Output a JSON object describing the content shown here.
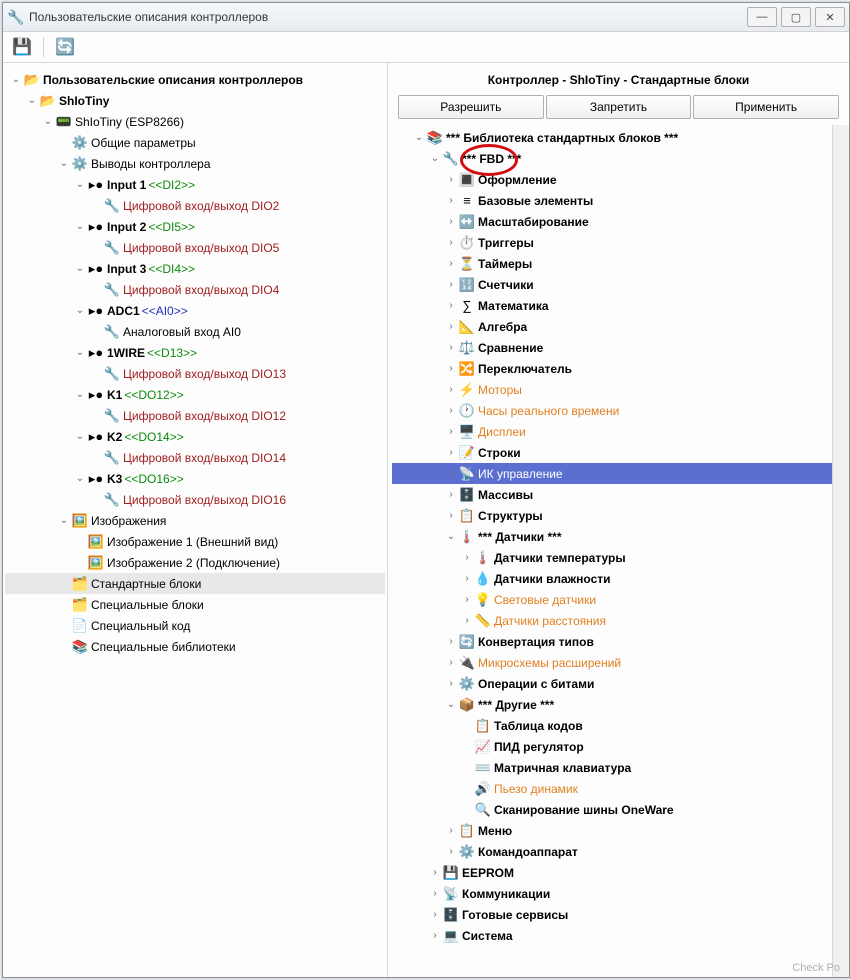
{
  "window_title": "Пользовательские описания контроллеров",
  "right_heading": "Контроллер - ShIoTiny - Стандартные блоки",
  "buttons": {
    "allow": "Разрешить",
    "deny": "Запретить",
    "apply": "Применить"
  },
  "left_tree": [
    {
      "ind": 0,
      "exp": "v",
      "ico": "📂",
      "lbl": "Пользовательские описания контроллеров",
      "b": true
    },
    {
      "ind": 1,
      "exp": "v",
      "ico": "📂",
      "lbl": "ShIoTiny",
      "b": true
    },
    {
      "ind": 2,
      "exp": "v",
      "ico": "📟",
      "lbl": "ShIoTiny (ESP8266)"
    },
    {
      "ind": 3,
      "exp": "",
      "ico": "⚙️",
      "lbl": "Общие параметры"
    },
    {
      "ind": 3,
      "exp": "v",
      "ico": "⚙️",
      "lbl": "Выводы контроллера"
    },
    {
      "ind": 4,
      "exp": "v",
      "ico": "▸●",
      "lbl": "Input 1 ",
      "b": true,
      "sfx": "<<DI2>>",
      "sfxc": "green"
    },
    {
      "ind": 5,
      "exp": "",
      "ico": "🔧",
      "lbl": "Цифровой вход/выход DIO2",
      "c": "red"
    },
    {
      "ind": 4,
      "exp": "v",
      "ico": "▸●",
      "lbl": "Input 2 ",
      "b": true,
      "sfx": "<<DI5>>",
      "sfxc": "green"
    },
    {
      "ind": 5,
      "exp": "",
      "ico": "🔧",
      "lbl": "Цифровой вход/выход DIO5",
      "c": "red"
    },
    {
      "ind": 4,
      "exp": "v",
      "ico": "▸●",
      "lbl": "Input 3 ",
      "b": true,
      "sfx": "<<DI4>>",
      "sfxc": "green"
    },
    {
      "ind": 5,
      "exp": "",
      "ico": "🔧",
      "lbl": "Цифровой вход/выход DIO4",
      "c": "red"
    },
    {
      "ind": 4,
      "exp": "v",
      "ico": "▸●",
      "lbl": "ADC1 ",
      "b": true,
      "sfx": "<<AI0>>",
      "sfxc": "blue"
    },
    {
      "ind": 5,
      "exp": "",
      "ico": "🔧",
      "lbl": "Аналоговый вход AI0"
    },
    {
      "ind": 4,
      "exp": "v",
      "ico": "▸●",
      "lbl": "1WIRE ",
      "b": true,
      "sfx": "<<D13>>",
      "sfxc": "green"
    },
    {
      "ind": 5,
      "exp": "",
      "ico": "🔧",
      "lbl": "Цифровой вход/выход DIO13",
      "c": "red"
    },
    {
      "ind": 4,
      "exp": "v",
      "ico": "▸●",
      "lbl": "K1 ",
      "b": true,
      "sfx": "<<DO12>>",
      "sfxc": "green"
    },
    {
      "ind": 5,
      "exp": "",
      "ico": "🔧",
      "lbl": "Цифровой вход/выход DIO12",
      "c": "red"
    },
    {
      "ind": 4,
      "exp": "v",
      "ico": "▸●",
      "lbl": "K2 ",
      "b": true,
      "sfx": "<<DO14>>",
      "sfxc": "green"
    },
    {
      "ind": 5,
      "exp": "",
      "ico": "🔧",
      "lbl": "Цифровой вход/выход DIO14",
      "c": "red"
    },
    {
      "ind": 4,
      "exp": "v",
      "ico": "▸●",
      "lbl": "K3 ",
      "b": true,
      "sfx": "<<DO16>>",
      "sfxc": "green"
    },
    {
      "ind": 5,
      "exp": "",
      "ico": "🔧",
      "lbl": "Цифровой вход/выход DIO16",
      "c": "red"
    },
    {
      "ind": 3,
      "exp": "v",
      "ico": "🖼️",
      "lbl": "Изображения"
    },
    {
      "ind": 4,
      "exp": "",
      "ico": "🖼️",
      "lbl": "Изображение 1 (Внешний вид)"
    },
    {
      "ind": 4,
      "exp": "",
      "ico": "🖼️",
      "lbl": "Изображение 2 (Подключение)"
    },
    {
      "ind": 3,
      "exp": "",
      "ico": "🗂️",
      "lbl": "Стандартные блоки",
      "sel": true
    },
    {
      "ind": 3,
      "exp": "",
      "ico": "🗂️",
      "lbl": "Специальные блоки"
    },
    {
      "ind": 3,
      "exp": "",
      "ico": "📄",
      "lbl": "Специальный код"
    },
    {
      "ind": 3,
      "exp": "",
      "ico": "📚",
      "lbl": "Специальные библиотеки"
    }
  ],
  "right_tree": [
    {
      "ind": 1,
      "exp": "v",
      "ico": "📚",
      "lbl": "*** Библиотека стандартных блоков ***",
      "b": true
    },
    {
      "ind": 2,
      "exp": "v",
      "ico": "🔧",
      "lbl": "*** FBD ***",
      "b": true
    },
    {
      "ind": 3,
      "exp": ">",
      "ico": "🔳",
      "lbl": "Оформление",
      "b": true
    },
    {
      "ind": 3,
      "exp": ">",
      "ico": "≡",
      "lbl": "Базовые элементы",
      "b": true
    },
    {
      "ind": 3,
      "exp": ">",
      "ico": "↔️",
      "lbl": "Масштабирование",
      "b": true
    },
    {
      "ind": 3,
      "exp": ">",
      "ico": "⏱️",
      "lbl": "Триггеры",
      "b": true
    },
    {
      "ind": 3,
      "exp": ">",
      "ico": "⏳",
      "lbl": "Таймеры",
      "b": true
    },
    {
      "ind": 3,
      "exp": ">",
      "ico": "🔢",
      "lbl": "Счетчики",
      "b": true
    },
    {
      "ind": 3,
      "exp": ">",
      "ico": "∑",
      "lbl": "Математика",
      "b": true
    },
    {
      "ind": 3,
      "exp": ">",
      "ico": "📐",
      "lbl": "Алгебра",
      "b": true
    },
    {
      "ind": 3,
      "exp": ">",
      "ico": "⚖️",
      "lbl": "Сравнение",
      "b": true
    },
    {
      "ind": 3,
      "exp": ">",
      "ico": "🔀",
      "lbl": "Переключатель",
      "b": true
    },
    {
      "ind": 3,
      "exp": ">",
      "ico": "⚡",
      "lbl": "Моторы",
      "c": "orange"
    },
    {
      "ind": 3,
      "exp": ">",
      "ico": "🕐",
      "lbl": "Часы реального времени",
      "c": "orange"
    },
    {
      "ind": 3,
      "exp": ">",
      "ico": "🖥️",
      "lbl": "Дисплеи",
      "c": "orange"
    },
    {
      "ind": 3,
      "exp": ">",
      "ico": "📝",
      "lbl": "Строки",
      "b": true
    },
    {
      "ind": 3,
      "exp": ">",
      "ico": "📡",
      "lbl": "ИК управление",
      "c": "orange",
      "sel": true
    },
    {
      "ind": 3,
      "exp": ">",
      "ico": "🗄️",
      "lbl": "Массивы",
      "b": true
    },
    {
      "ind": 3,
      "exp": ">",
      "ico": "📋",
      "lbl": "Структуры",
      "b": true
    },
    {
      "ind": 3,
      "exp": "v",
      "ico": "🌡️",
      "lbl": "*** Датчики ***",
      "b": true
    },
    {
      "ind": 4,
      "exp": ">",
      "ico": "🌡️",
      "lbl": "Датчики температуры",
      "b": true
    },
    {
      "ind": 4,
      "exp": ">",
      "ico": "💧",
      "lbl": "Датчики влажности",
      "b": true
    },
    {
      "ind": 4,
      "exp": ">",
      "ico": "💡",
      "lbl": "Световые датчики",
      "c": "orange"
    },
    {
      "ind": 4,
      "exp": ">",
      "ico": "📏",
      "lbl": "Датчики расстояния",
      "c": "orange"
    },
    {
      "ind": 3,
      "exp": ">",
      "ico": "🔄",
      "lbl": "Конвертация типов",
      "b": true
    },
    {
      "ind": 3,
      "exp": ">",
      "ico": "🔌",
      "lbl": "Микросхемы расширений",
      "c": "orange"
    },
    {
      "ind": 3,
      "exp": ">",
      "ico": "⚙️",
      "lbl": "Операции с битами",
      "b": true
    },
    {
      "ind": 3,
      "exp": "v",
      "ico": "📦",
      "lbl": "*** Другие ***",
      "b": true
    },
    {
      "ind": 4,
      "exp": "",
      "ico": "📋",
      "lbl": "Таблица кодов",
      "b": true
    },
    {
      "ind": 4,
      "exp": "",
      "ico": "📈",
      "lbl": "ПИД регулятор",
      "b": true
    },
    {
      "ind": 4,
      "exp": "",
      "ico": "⌨️",
      "lbl": "Матричная клавиатура",
      "b": true
    },
    {
      "ind": 4,
      "exp": "",
      "ico": "🔊",
      "lbl": "Пьезо динамик",
      "c": "orange"
    },
    {
      "ind": 4,
      "exp": "",
      "ico": "🔍",
      "lbl": "Сканирование шины OneWare",
      "b": true
    },
    {
      "ind": 3,
      "exp": ">",
      "ico": "📋",
      "lbl": "Меню",
      "b": true
    },
    {
      "ind": 3,
      "exp": ">",
      "ico": "⚙️",
      "lbl": "Командоаппарат",
      "b": true
    },
    {
      "ind": 2,
      "exp": ">",
      "ico": "💾",
      "lbl": "EEPROM",
      "b": true
    },
    {
      "ind": 2,
      "exp": ">",
      "ico": "📡",
      "lbl": "Коммуникации",
      "b": true
    },
    {
      "ind": 2,
      "exp": ">",
      "ico": "🗄️",
      "lbl": "Готовые сервисы",
      "b": true
    },
    {
      "ind": 2,
      "exp": ">",
      "ico": "💻",
      "lbl": "Система",
      "b": true
    }
  ],
  "footer": "Check Po"
}
